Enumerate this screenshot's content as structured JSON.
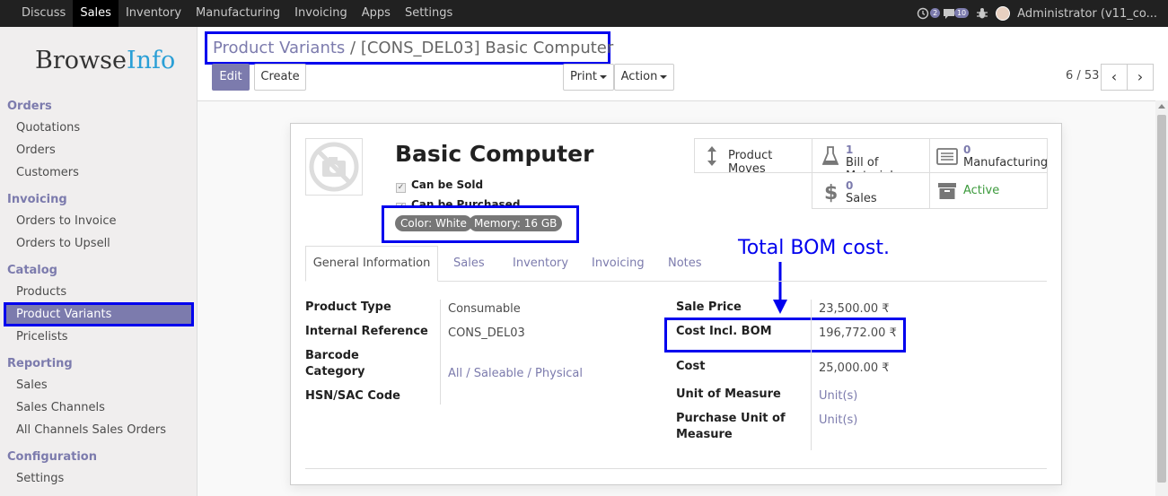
{
  "topnav": {
    "menu": [
      "Discuss",
      "Sales",
      "Inventory",
      "Manufacturing",
      "Invoicing",
      "Apps",
      "Settings"
    ],
    "active": "Sales",
    "activity_count": "2",
    "message_count": "10",
    "user": "Administrator (v11_co..."
  },
  "logo": {
    "part1": "Browse",
    "part2": "Info"
  },
  "sidebar": {
    "sections": [
      {
        "title": "Orders",
        "items": [
          "Quotations",
          "Orders",
          "Customers"
        ]
      },
      {
        "title": "Invoicing",
        "items": [
          "Orders to Invoice",
          "Orders to Upsell"
        ]
      },
      {
        "title": "Catalog",
        "items": [
          "Products",
          "Product Variants",
          "Pricelists"
        ]
      },
      {
        "title": "Reporting",
        "items": [
          "Sales",
          "Sales Channels",
          "All Channels Sales Orders"
        ]
      },
      {
        "title": "Configuration",
        "items": [
          "Settings"
        ]
      }
    ],
    "active_item": "Product Variants"
  },
  "breadcrumb": {
    "parent": "Product Variants",
    "separator": "/",
    "current": "[CONS_DEL03] Basic Computer"
  },
  "buttons": {
    "edit": "Edit",
    "create": "Create",
    "print": "Print",
    "action": "Action"
  },
  "pager": {
    "text": "6 / 53",
    "prev": "‹",
    "next": "›"
  },
  "product": {
    "name": "Basic Computer",
    "can_be_sold": "Can be Sold",
    "can_be_purchased": "Can be Purchased",
    "attributes": [
      "Color: White",
      "Memory: 16 GB"
    ]
  },
  "smart_buttons": {
    "moves": {
      "label": "Product Moves"
    },
    "bom": {
      "count": "1",
      "label": "Bill of Materials"
    },
    "manufacturing": {
      "count": "0",
      "label": "Manufacturing"
    },
    "sales": {
      "count": "0",
      "label": "Sales"
    },
    "active": {
      "label": "Active"
    }
  },
  "annotation": "Total BOM cost.",
  "tabs": [
    "General Information",
    "Sales",
    "Inventory",
    "Invoicing",
    "Notes"
  ],
  "left_fields": {
    "product_type": {
      "label": "Product Type",
      "value": "Consumable"
    },
    "internal_reference": {
      "label": "Internal Reference",
      "value": "CONS_DEL03"
    },
    "barcode_label": "Barcode",
    "category": {
      "label": "Category",
      "value": "All / Saleable / Physical"
    },
    "hsn": {
      "label": "HSN/SAC Code",
      "value": ""
    }
  },
  "right_fields": {
    "sale_price": {
      "label": "Sale Price",
      "value": "23,500.00 ₹"
    },
    "cost_bom": {
      "label": "Cost Incl. BOM",
      "value": "196,772.00 ₹"
    },
    "cost": {
      "label": "Cost",
      "value": "25,000.00 ₹"
    },
    "uom": {
      "label": "Unit of Measure",
      "value": "Unit(s)"
    },
    "purchase_uom": {
      "label_line1": "Purchase Unit of",
      "label_line2": "Measure",
      "value": "Unit(s)"
    }
  },
  "colors": {
    "accent": "#7c7bad",
    "annotation": "#0000ee",
    "active_green": "#3c9a3c"
  }
}
